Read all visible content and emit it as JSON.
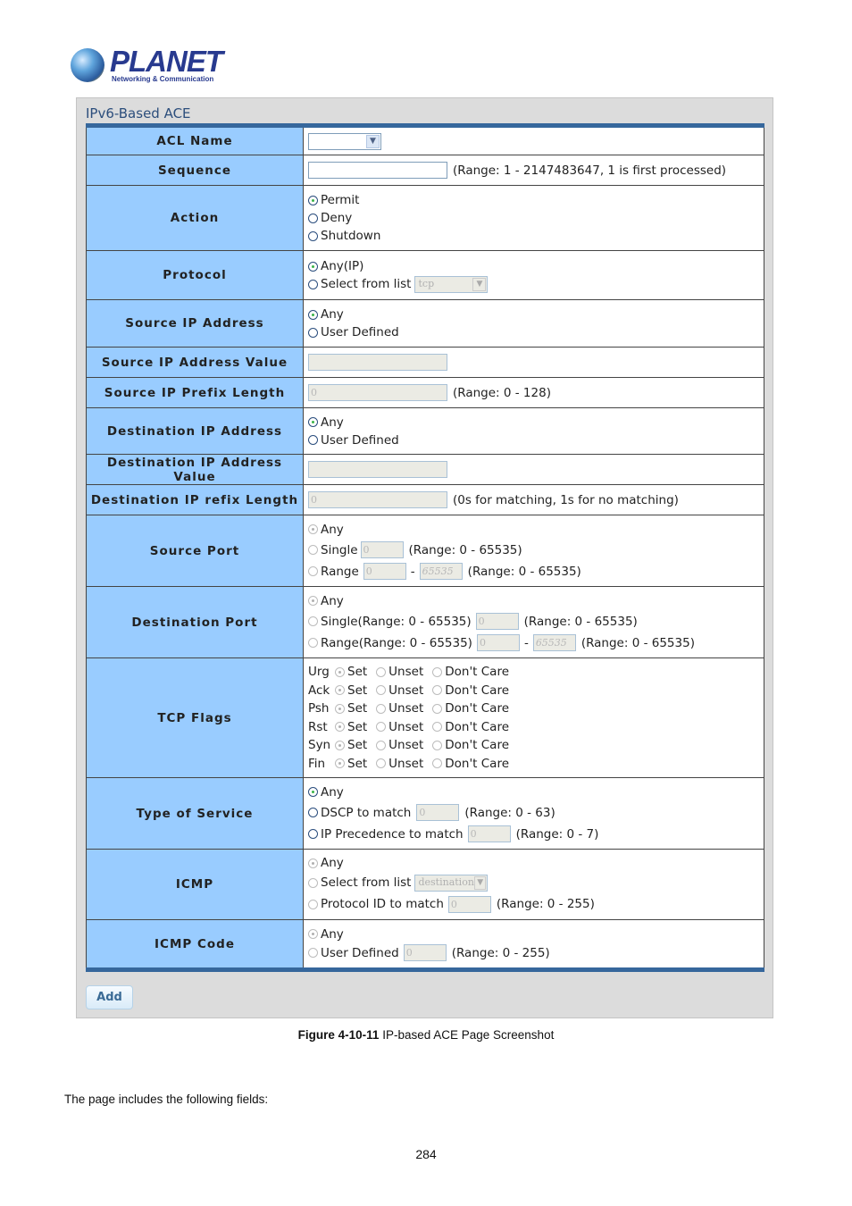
{
  "logo": {
    "brand": "PLANET",
    "tagline": "Networking & Communication"
  },
  "panel": {
    "title": "IPv6-Based ACE",
    "rows": {
      "acl_name": {
        "label": "ACL Name",
        "value": ""
      },
      "sequence": {
        "label": "Sequence",
        "value": "",
        "note": "(Range: 1 - 2147483647, 1 is first processed)"
      },
      "action": {
        "label": "Action",
        "options": [
          "Permit",
          "Deny",
          "Shutdown"
        ],
        "selected": "Permit"
      },
      "protocol": {
        "label": "Protocol",
        "opt_any": "Any(IP)",
        "opt_list": "Select from list",
        "list_value": "tcp",
        "selected": "Any(IP)"
      },
      "source_ip_address": {
        "label": "Source IP Address",
        "opt_any": "Any",
        "opt_user": "User Defined",
        "selected": "Any"
      },
      "source_ip_address_value": {
        "label": "Source IP Address Value",
        "value": ""
      },
      "source_ip_prefix_length": {
        "label": "Source IP Prefix Length",
        "value": "0",
        "note": "(Range: 0 - 128)"
      },
      "destination_ip_address": {
        "label": "Destination IP Address",
        "opt_any": "Any",
        "opt_user": "User Defined",
        "selected": "Any"
      },
      "destination_ip_address_value": {
        "label": "Destination IP Address Value",
        "value": ""
      },
      "destination_ip_prefix_length": {
        "label": "Destination IP refix Length",
        "value": "0",
        "note": "(0s for matching, 1s for no matching)"
      },
      "source_port": {
        "label": "Source Port",
        "opt_any": "Any",
        "opt_single": "Single",
        "single_value": "0",
        "single_note": "(Range: 0 - 65535)",
        "opt_range": "Range",
        "range_from": "0",
        "range_to": "65535",
        "range_note": "(Range: 0 - 65535)",
        "selected": "Any"
      },
      "destination_port": {
        "label": "Destination Port",
        "opt_any": "Any",
        "opt_single": "Single(Range: 0 - 65535)",
        "single_value": "0",
        "single_note": "(Range: 0 - 65535)",
        "opt_range": "Range(Range: 0 - 65535)",
        "range_from": "0",
        "range_to": "65535",
        "range_note": "(Range: 0 - 65535)",
        "selected": "Any"
      },
      "tcp_flags": {
        "label": "TCP Flags",
        "option_labels": {
          "set": "Set",
          "unset": "Unset",
          "dont_care": "Don't Care"
        },
        "flags": [
          {
            "name": "Urg",
            "selected": "Set"
          },
          {
            "name": "Ack",
            "selected": "Set"
          },
          {
            "name": "Psh",
            "selected": "Set"
          },
          {
            "name": "Rst",
            "selected": "Set"
          },
          {
            "name": "Syn",
            "selected": "Set"
          },
          {
            "name": "Fin",
            "selected": "Set"
          }
        ]
      },
      "type_of_service": {
        "label": "Type of Service",
        "opt_any": "Any",
        "opt_dscp": "DSCP to match",
        "dscp_value": "0",
        "dscp_note": "(Range: 0 - 63)",
        "opt_prec": "IP Precedence to match",
        "prec_value": "0",
        "prec_note": "(Range: 0 - 7)",
        "selected": "Any"
      },
      "icmp": {
        "label": "ICMP",
        "opt_any": "Any",
        "opt_list": "Select from list",
        "list_value": "destination",
        "opt_proto": "Protocol ID to match",
        "proto_value": "0",
        "proto_note": "(Range: 0 - 255)",
        "selected": "Any"
      },
      "icmp_code": {
        "label": "ICMP Code",
        "opt_any": "Any",
        "opt_user": "User Defined",
        "user_value": "0",
        "user_note": "(Range: 0 - 255)",
        "selected": "Any"
      }
    },
    "add_button": "Add"
  },
  "caption": {
    "figure": "Figure 4-10-11",
    "text": " IP-based ACE Page Screenshot"
  },
  "body_text": "The page includes the following fields:",
  "page_number": "284"
}
